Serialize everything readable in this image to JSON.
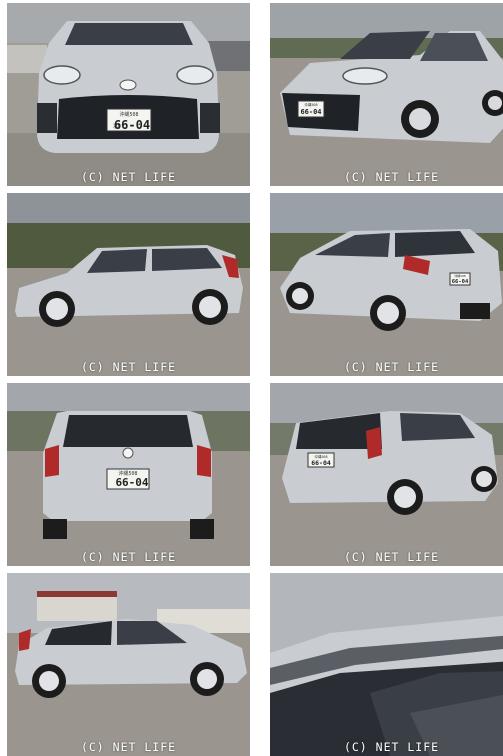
{
  "gallery": {
    "watermark": "(C) NET LIFE",
    "plate_region": "沖縄508",
    "plate_kana": "れ",
    "plate_number": "66-04",
    "car_color": "#c9ccd0",
    "photos": [
      {
        "view": "front"
      },
      {
        "view": "front-right three-quarter"
      },
      {
        "view": "left side"
      },
      {
        "view": "rear-left three-quarter"
      },
      {
        "view": "rear"
      },
      {
        "view": "rear-right three-quarter"
      },
      {
        "view": "left side"
      },
      {
        "view": "roof close-up"
      }
    ]
  }
}
